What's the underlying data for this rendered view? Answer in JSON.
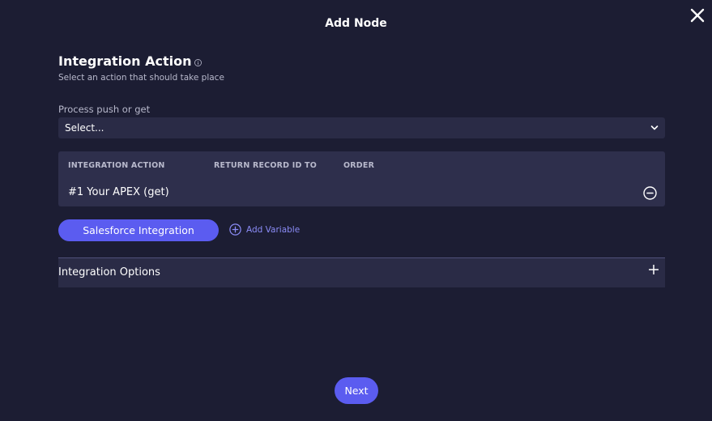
{
  "modal": {
    "title": "Add Node"
  },
  "section": {
    "title": "Integration Action",
    "subtitle": "Select an action that should take place"
  },
  "process_field": {
    "label": "Process push or get",
    "value": "Select..."
  },
  "table": {
    "headers": [
      "INTEGRATION ACTION",
      "RETURN RECORD ID TO",
      "ORDER"
    ],
    "rows": [
      {
        "label": "#1 Your APEX (get)"
      }
    ]
  },
  "actions": {
    "salesforce_label": "Salesforce Integration",
    "add_variable_label": "Add Variable"
  },
  "accordion": {
    "label": "Integration Options"
  },
  "footer": {
    "next_label": "Next"
  },
  "icons": {
    "close": "close-icon",
    "info": "info-icon",
    "chevron": "chevron-down-icon",
    "remove": "minus-circle-icon",
    "add": "plus-circle-icon",
    "expand": "plus-icon"
  },
  "colors": {
    "background": "#1c1d33",
    "surface": "#2a2b46",
    "accent": "#5b5cf0",
    "link": "#8b8cf7"
  }
}
